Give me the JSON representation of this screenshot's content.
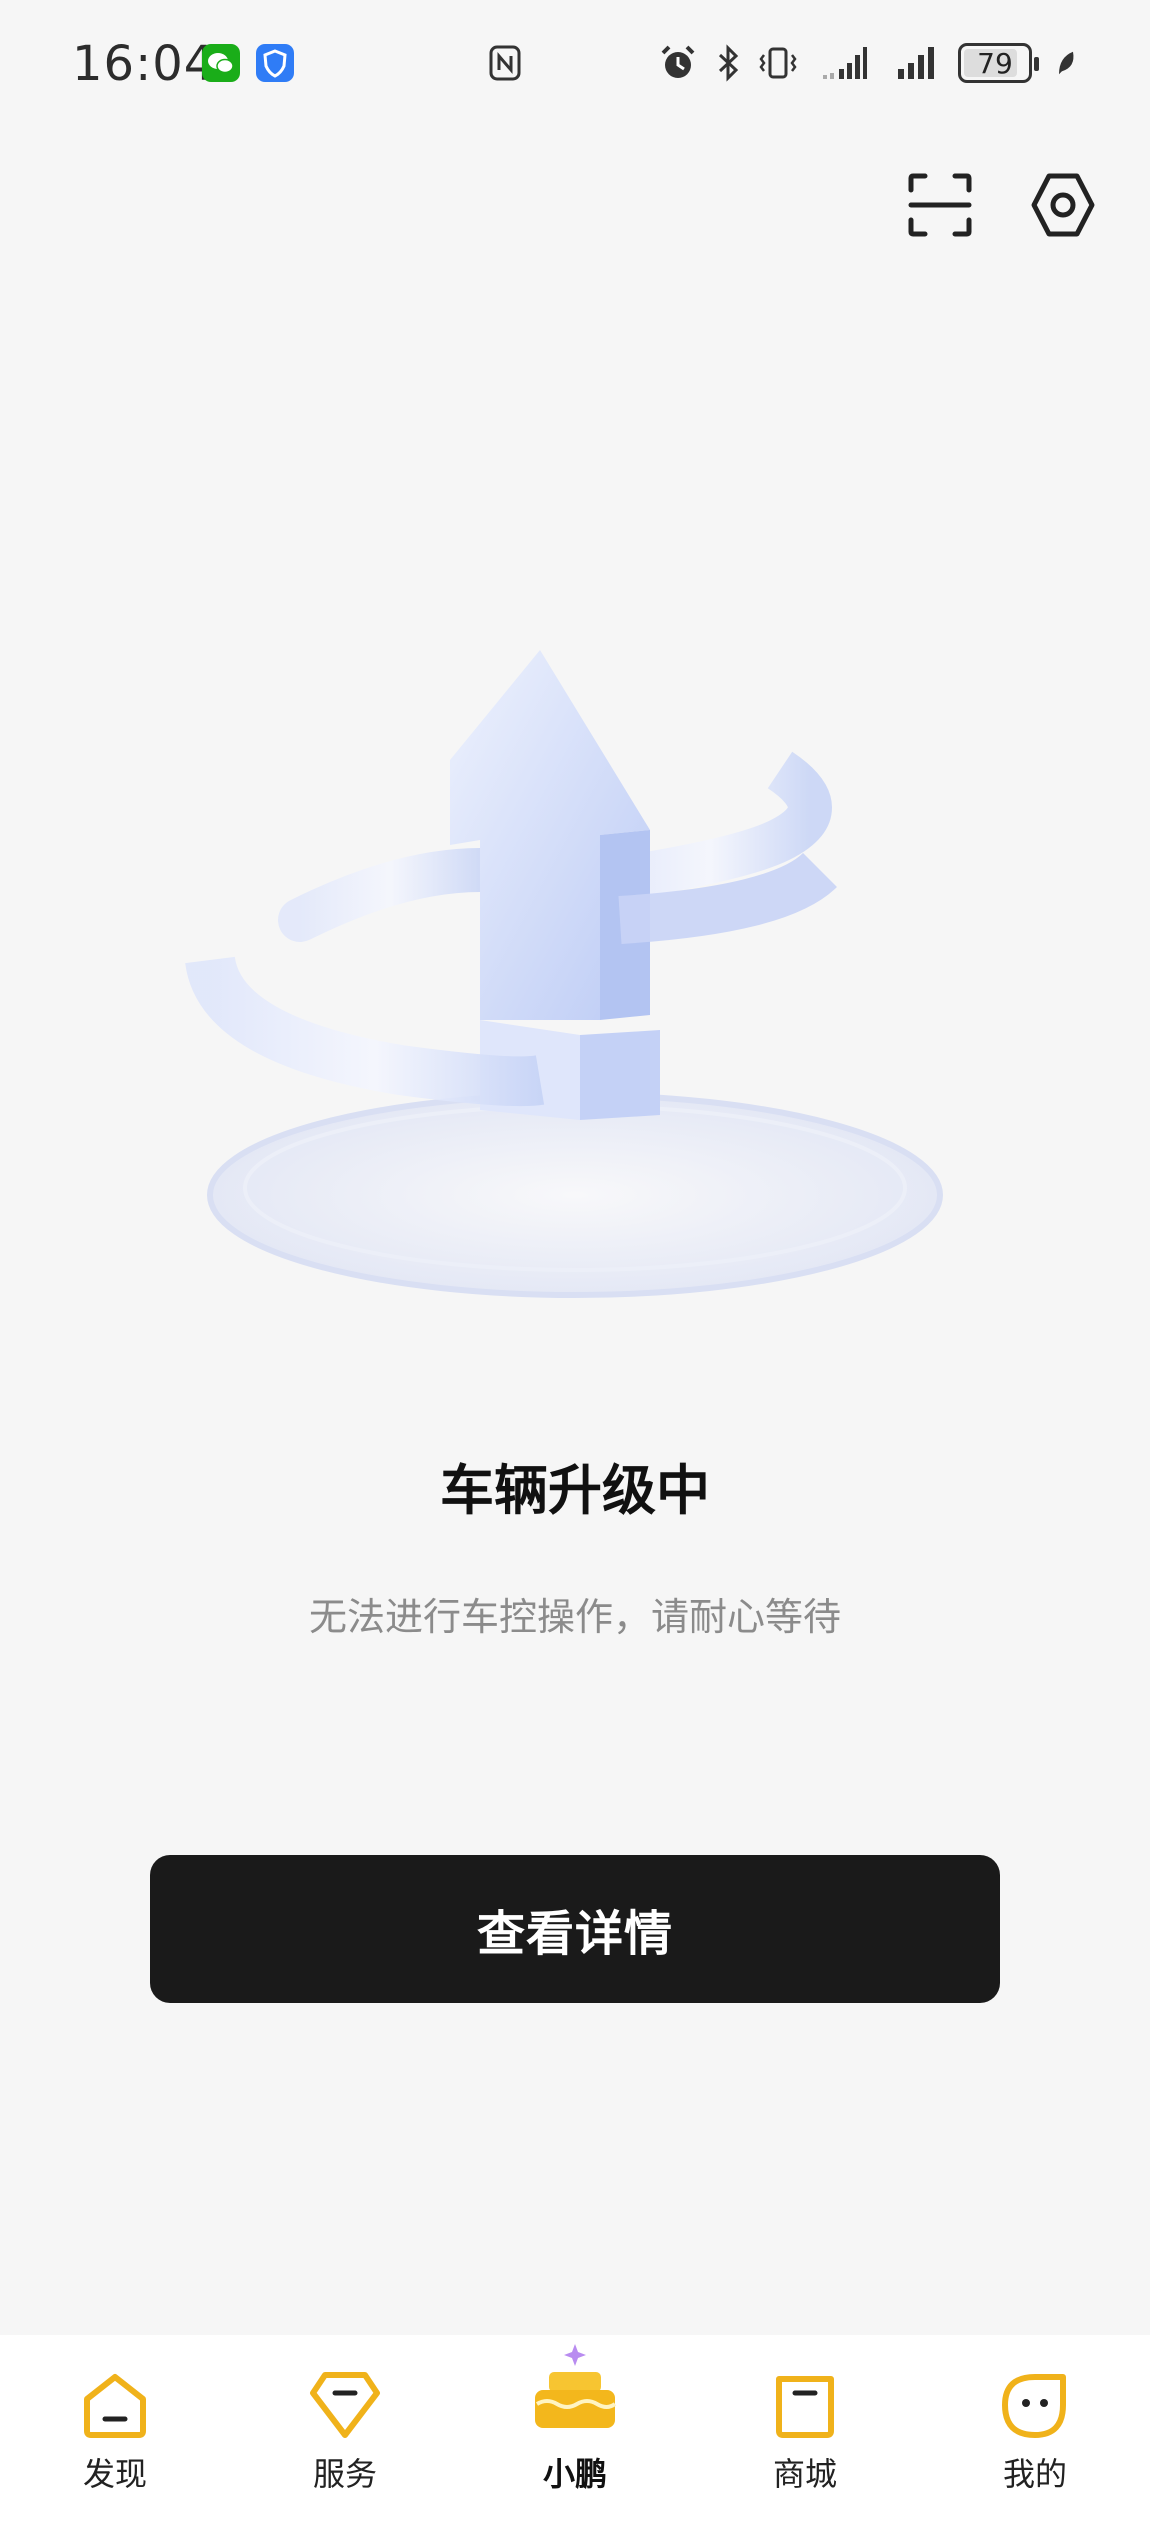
{
  "status_bar": {
    "time": "16:04",
    "battery_level": "79",
    "icons": [
      "wechat-icon",
      "shield-app-icon",
      "nfc-icon",
      "alarm-icon",
      "bluetooth-icon",
      "vibrate-icon",
      "signal-icon",
      "signal-icon",
      "battery-icon",
      "leaf-icon"
    ]
  },
  "header": {
    "scan_icon": "scan-icon",
    "settings_icon": "settings-icon"
  },
  "main": {
    "title": "车辆升级中",
    "subtitle": "无法进行车控操作，请耐心等待",
    "details_button": "查看详情"
  },
  "tabs": [
    {
      "label": "发现",
      "icon": "home-icon"
    },
    {
      "label": "服务",
      "icon": "service-icon"
    },
    {
      "label": "小鹏",
      "icon": "cake-icon",
      "active": true
    },
    {
      "label": "商城",
      "icon": "shopping-bag-icon"
    },
    {
      "label": "我的",
      "icon": "profile-face-icon"
    }
  ],
  "colors": {
    "background": "#f6f6f6",
    "button": "#1a1a1a",
    "accent": "#f0b21a",
    "illustration": "#c9d4f6"
  }
}
